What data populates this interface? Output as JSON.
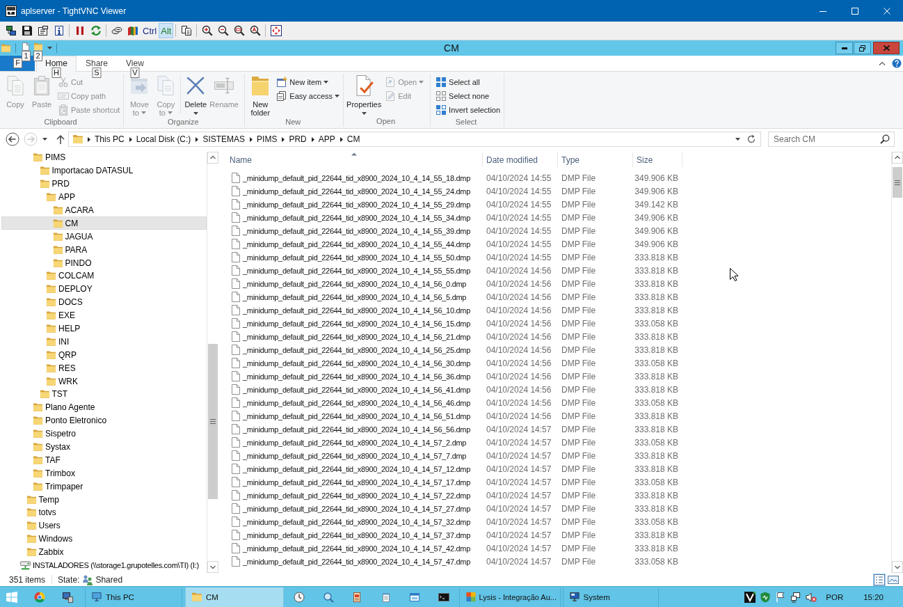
{
  "vnc_window": {
    "title": "aplserver - TightVNC Viewer"
  },
  "vnc_toolbar": {
    "key_buttons": [
      {
        "kind": "ctrl",
        "label": "Ctrl",
        "pressed": false
      },
      {
        "kind": "alt",
        "label": "Alt",
        "pressed": true
      }
    ]
  },
  "explorer": {
    "title": "CM",
    "quick_access": [
      {
        "keytip": "1"
      },
      {
        "keytip": "2"
      }
    ],
    "ribbon_tabs": [
      {
        "kind": "file",
        "keytip": "F",
        "selected": false
      },
      {
        "kind": "tab",
        "label": "Home",
        "keytip": "H",
        "selected": true
      },
      {
        "kind": "tab",
        "label": "Share",
        "keytip": "S",
        "selected": false
      },
      {
        "kind": "tab",
        "label": "View",
        "keytip": "V",
        "selected": false
      }
    ],
    "ribbon_groups": [
      {
        "label": "Clipboard",
        "buttons": [
          {
            "kind": "large",
            "label": "Copy",
            "disabled": true,
            "dropdown": false
          },
          {
            "kind": "large",
            "label": "Paste",
            "disabled": true,
            "dropdown": false
          },
          {
            "kind": "small",
            "label": "Cut",
            "disabled": true,
            "dropdown": false
          },
          {
            "kind": "small",
            "label": "Copy path",
            "disabled": true,
            "dropdown": false
          },
          {
            "kind": "small",
            "label": "Paste shortcut",
            "disabled": true,
            "dropdown": false
          }
        ]
      },
      {
        "label": "Organize",
        "buttons": [
          {
            "kind": "large",
            "label": "Move to",
            "disabled": true,
            "dropdown": true
          },
          {
            "kind": "large",
            "label": "Copy to",
            "disabled": true,
            "dropdown": true
          },
          {
            "kind": "large",
            "label": "Delete",
            "disabled": false,
            "dropdown": true
          },
          {
            "kind": "large",
            "label": "Rename",
            "disabled": true,
            "dropdown": false
          }
        ]
      },
      {
        "label": "New",
        "buttons": [
          {
            "kind": "large",
            "label": "New folder",
            "disabled": false,
            "dropdown": false
          },
          {
            "kind": "small",
            "label": "New item",
            "disabled": false,
            "dropdown": true
          },
          {
            "kind": "small",
            "label": "Easy access",
            "disabled": false,
            "dropdown": true
          }
        ]
      },
      {
        "label": "Open",
        "buttons": [
          {
            "kind": "large",
            "label": "Properties",
            "disabled": false,
            "dropdown": true
          },
          {
            "kind": "small",
            "label": "Open",
            "disabled": true,
            "dropdown": true
          },
          {
            "kind": "small",
            "label": "Edit",
            "disabled": true,
            "dropdown": false
          }
        ]
      },
      {
        "label": "Select",
        "buttons": [
          {
            "kind": "small",
            "label": "Select all",
            "disabled": false,
            "dropdown": false
          },
          {
            "kind": "small",
            "label": "Select none",
            "disabled": false,
            "dropdown": false
          },
          {
            "kind": "small",
            "label": "Invert selection",
            "disabled": false,
            "dropdown": false
          }
        ]
      }
    ],
    "address_bar": {
      "nav": [
        {
          "kind": "back",
          "disabled": false
        },
        {
          "kind": "forward",
          "disabled": true
        },
        {
          "kind": "recent",
          "disabled": false
        },
        {
          "kind": "up",
          "disabled": false
        }
      ],
      "crumbs": [
        "This PC",
        "Local Disk (C:)",
        "SISTEMAS",
        "PIMS",
        "PRD",
        "APP",
        "CM"
      ]
    },
    "search": {
      "placeholder": "Search CM"
    },
    "tree": [
      {
        "children": [
          {
            "children": [
              {
                "kind": "folder",
                "label": "PIMS",
                "selected": false,
                "children": [
                  {
                    "kind": "folder",
                    "label": "Importacao DATASUL",
                    "selected": false
                  },
                  {
                    "kind": "folder",
                    "label": "PRD",
                    "selected": false,
                    "children": [
                      {
                        "kind": "folder",
                        "label": "APP",
                        "selected": false,
                        "children": [
                          {
                            "kind": "folder",
                            "label": "ACARA",
                            "selected": false
                          },
                          {
                            "kind": "folder",
                            "label": "CM",
                            "selected": true
                          },
                          {
                            "kind": "folder",
                            "label": "JAGUA",
                            "selected": false
                          },
                          {
                            "kind": "folder",
                            "label": "PARA",
                            "selected": false
                          },
                          {
                            "kind": "folder",
                            "label": "PINDO",
                            "selected": false
                          }
                        ]
                      },
                      {
                        "kind": "folder",
                        "label": "COLCAM",
                        "selected": false
                      },
                      {
                        "kind": "folder",
                        "label": "DEPLOY",
                        "selected": false
                      },
                      {
                        "kind": "folder",
                        "label": "DOCS",
                        "selected": false
                      },
                      {
                        "kind": "folder",
                        "label": "EXE",
                        "selected": false
                      },
                      {
                        "kind": "folder",
                        "label": "HELP",
                        "selected": false
                      },
                      {
                        "kind": "folder",
                        "label": "INI",
                        "selected": false
                      },
                      {
                        "kind": "folder",
                        "label": "QRP",
                        "selected": false
                      },
                      {
                        "kind": "folder",
                        "label": "RES",
                        "selected": false
                      },
                      {
                        "kind": "folder",
                        "label": "WRK",
                        "selected": false
                      }
                    ]
                  },
                  {
                    "kind": "folder",
                    "label": "TST",
                    "selected": false
                  }
                ]
              },
              {
                "kind": "folder",
                "label": "Plano Agente",
                "selected": false
              },
              {
                "kind": "folder",
                "label": "Ponto Eletronico",
                "selected": false
              },
              {
                "kind": "folder",
                "label": "Sispetro",
                "selected": false
              },
              {
                "kind": "folder",
                "label": "Systax",
                "selected": false
              },
              {
                "kind": "folder",
                "label": "TAF",
                "selected": false
              },
              {
                "kind": "folder",
                "label": "Trimbox",
                "selected": false
              },
              {
                "kind": "folder",
                "label": "Trimpaper",
                "selected": false
              }
            ]
          },
          {
            "kind": "folder",
            "label": "Temp",
            "selected": false
          },
          {
            "kind": "folder",
            "label": "totvs",
            "selected": false
          },
          {
            "kind": "folder",
            "label": "Users",
            "selected": false
          },
          {
            "kind": "folder",
            "label": "Windows",
            "selected": false
          },
          {
            "kind": "folder",
            "label": "Zabbix",
            "selected": false
          }
        ]
      },
      {
        "kind": "network-drive",
        "label": "INSTALADORES (\\\\storage1.grupotelles.com\\TI) (I:)",
        "selected": false
      }
    ],
    "file_list": {
      "columns": [
        {
          "label": "Name",
          "sorted": true
        },
        {
          "label": "Date modified",
          "sorted": false
        },
        {
          "label": "Type",
          "sorted": false
        },
        {
          "label": "Size",
          "sorted": false
        }
      ],
      "rows": [
        {
          "name": "_minidump_default_pid_22644_tid_x8900_2024_10_4_14_55_18.dmp",
          "date": "04/10/2024 14:55",
          "type": "DMP File",
          "size": "349.906 KB"
        },
        {
          "name": "_minidump_default_pid_22644_tid_x8900_2024_10_4_14_55_24.dmp",
          "date": "04/10/2024 14:55",
          "type": "DMP File",
          "size": "349.906 KB"
        },
        {
          "name": "_minidump_default_pid_22644_tid_x8900_2024_10_4_14_55_29.dmp",
          "date": "04/10/2024 14:55",
          "type": "DMP File",
          "size": "349.142 KB"
        },
        {
          "name": "_minidump_default_pid_22644_tid_x8900_2024_10_4_14_55_34.dmp",
          "date": "04/10/2024 14:55",
          "type": "DMP File",
          "size": "349.906 KB"
        },
        {
          "name": "_minidump_default_pid_22644_tid_x8900_2024_10_4_14_55_39.dmp",
          "date": "04/10/2024 14:55",
          "type": "DMP File",
          "size": "349.906 KB"
        },
        {
          "name": "_minidump_default_pid_22644_tid_x8900_2024_10_4_14_55_44.dmp",
          "date": "04/10/2024 14:55",
          "type": "DMP File",
          "size": "349.906 KB"
        },
        {
          "name": "_minidump_default_pid_22644_tid_x8900_2024_10_4_14_55_50.dmp",
          "date": "04/10/2024 14:55",
          "type": "DMP File",
          "size": "333.818 KB"
        },
        {
          "name": "_minidump_default_pid_22644_tid_x8900_2024_10_4_14_55_55.dmp",
          "date": "04/10/2024 14:56",
          "type": "DMP File",
          "size": "333.818 KB"
        },
        {
          "name": "_minidump_default_pid_22644_tid_x8900_2024_10_4_14_56_0.dmp",
          "date": "04/10/2024 14:56",
          "type": "DMP File",
          "size": "333.818 KB"
        },
        {
          "name": "_minidump_default_pid_22644_tid_x8900_2024_10_4_14_56_5.dmp",
          "date": "04/10/2024 14:56",
          "type": "DMP File",
          "size": "333.818 KB"
        },
        {
          "name": "_minidump_default_pid_22644_tid_x8900_2024_10_4_14_56_10.dmp",
          "date": "04/10/2024 14:56",
          "type": "DMP File",
          "size": "333.818 KB"
        },
        {
          "name": "_minidump_default_pid_22644_tid_x8900_2024_10_4_14_56_15.dmp",
          "date": "04/10/2024 14:56",
          "type": "DMP File",
          "size": "333.058 KB"
        },
        {
          "name": "_minidump_default_pid_22644_tid_x8900_2024_10_4_14_56_21.dmp",
          "date": "04/10/2024 14:56",
          "type": "DMP File",
          "size": "333.818 KB"
        },
        {
          "name": "_minidump_default_pid_22644_tid_x8900_2024_10_4_14_56_25.dmp",
          "date": "04/10/2024 14:56",
          "type": "DMP File",
          "size": "333.818 KB"
        },
        {
          "name": "_minidump_default_pid_22644_tid_x8900_2024_10_4_14_56_30.dmp",
          "date": "04/10/2024 14:56",
          "type": "DMP File",
          "size": "333.058 KB"
        },
        {
          "name": "_minidump_default_pid_22644_tid_x8900_2024_10_4_14_56_36.dmp",
          "date": "04/10/2024 14:56",
          "type": "DMP File",
          "size": "333.818 KB"
        },
        {
          "name": "_minidump_default_pid_22644_tid_x8900_2024_10_4_14_56_41.dmp",
          "date": "04/10/2024 14:56",
          "type": "DMP File",
          "size": "333.818 KB"
        },
        {
          "name": "_minidump_default_pid_22644_tid_x8900_2024_10_4_14_56_46.dmp",
          "date": "04/10/2024 14:56",
          "type": "DMP File",
          "size": "333.058 KB"
        },
        {
          "name": "_minidump_default_pid_22644_tid_x8900_2024_10_4_14_56_51.dmp",
          "date": "04/10/2024 14:56",
          "type": "DMP File",
          "size": "333.818 KB"
        },
        {
          "name": "_minidump_default_pid_22644_tid_x8900_2024_10_4_14_56_56.dmp",
          "date": "04/10/2024 14:57",
          "type": "DMP File",
          "size": "333.818 KB"
        },
        {
          "name": "_minidump_default_pid_22644_tid_x8900_2024_10_4_14_57_2.dmp",
          "date": "04/10/2024 14:57",
          "type": "DMP File",
          "size": "333.058 KB"
        },
        {
          "name": "_minidump_default_pid_22644_tid_x8900_2024_10_4_14_57_7.dmp",
          "date": "04/10/2024 14:57",
          "type": "DMP File",
          "size": "333.818 KB"
        },
        {
          "name": "_minidump_default_pid_22644_tid_x8900_2024_10_4_14_57_12.dmp",
          "date": "04/10/2024 14:57",
          "type": "DMP File",
          "size": "333.818 KB"
        },
        {
          "name": "_minidump_default_pid_22644_tid_x8900_2024_10_4_14_57_17.dmp",
          "date": "04/10/2024 14:57",
          "type": "DMP File",
          "size": "333.058 KB"
        },
        {
          "name": "_minidump_default_pid_22644_tid_x8900_2024_10_4_14_57_22.dmp",
          "date": "04/10/2024 14:57",
          "type": "DMP File",
          "size": "333.818 KB"
        },
        {
          "name": "_minidump_default_pid_22644_tid_x8900_2024_10_4_14_57_27.dmp",
          "date": "04/10/2024 14:57",
          "type": "DMP File",
          "size": "333.818 KB"
        },
        {
          "name": "_minidump_default_pid_22644_tid_x8900_2024_10_4_14_57_32.dmp",
          "date": "04/10/2024 14:57",
          "type": "DMP File",
          "size": "333.058 KB"
        },
        {
          "name": "_minidump_default_pid_22644_tid_x8900_2024_10_4_14_57_37.dmp",
          "date": "04/10/2024 14:57",
          "type": "DMP File",
          "size": "333.818 KB"
        },
        {
          "name": "_minidump_default_pid_22644_tid_x8900_2024_10_4_14_57_42.dmp",
          "date": "04/10/2024 14:57",
          "type": "DMP File",
          "size": "333.818 KB"
        },
        {
          "name": "_minidump_default_pid_22644_tid_x8900_2024_10_4_14_57_47.dmp",
          "date": "04/10/2024 14:57",
          "type": "DMP File",
          "size": "333.058 KB"
        }
      ]
    },
    "status_bar": {
      "item_count": "351 items",
      "state_label": "State:",
      "state_value": "Shared",
      "views": [
        {
          "kind": "details",
          "selected": true
        },
        {
          "kind": "large-icons",
          "selected": false
        }
      ]
    }
  },
  "taskbar": {
    "windows": [
      {
        "kind": "this-pc",
        "label": "This PC",
        "selected": false
      },
      {
        "kind": "folder",
        "label": "CM",
        "selected": true
      },
      {
        "kind": "app",
        "label": "Lysis - Integração Au...",
        "selected": false
      },
      {
        "kind": "system",
        "label": "System",
        "selected": false
      }
    ],
    "language": "POR",
    "time": "15:20"
  }
}
